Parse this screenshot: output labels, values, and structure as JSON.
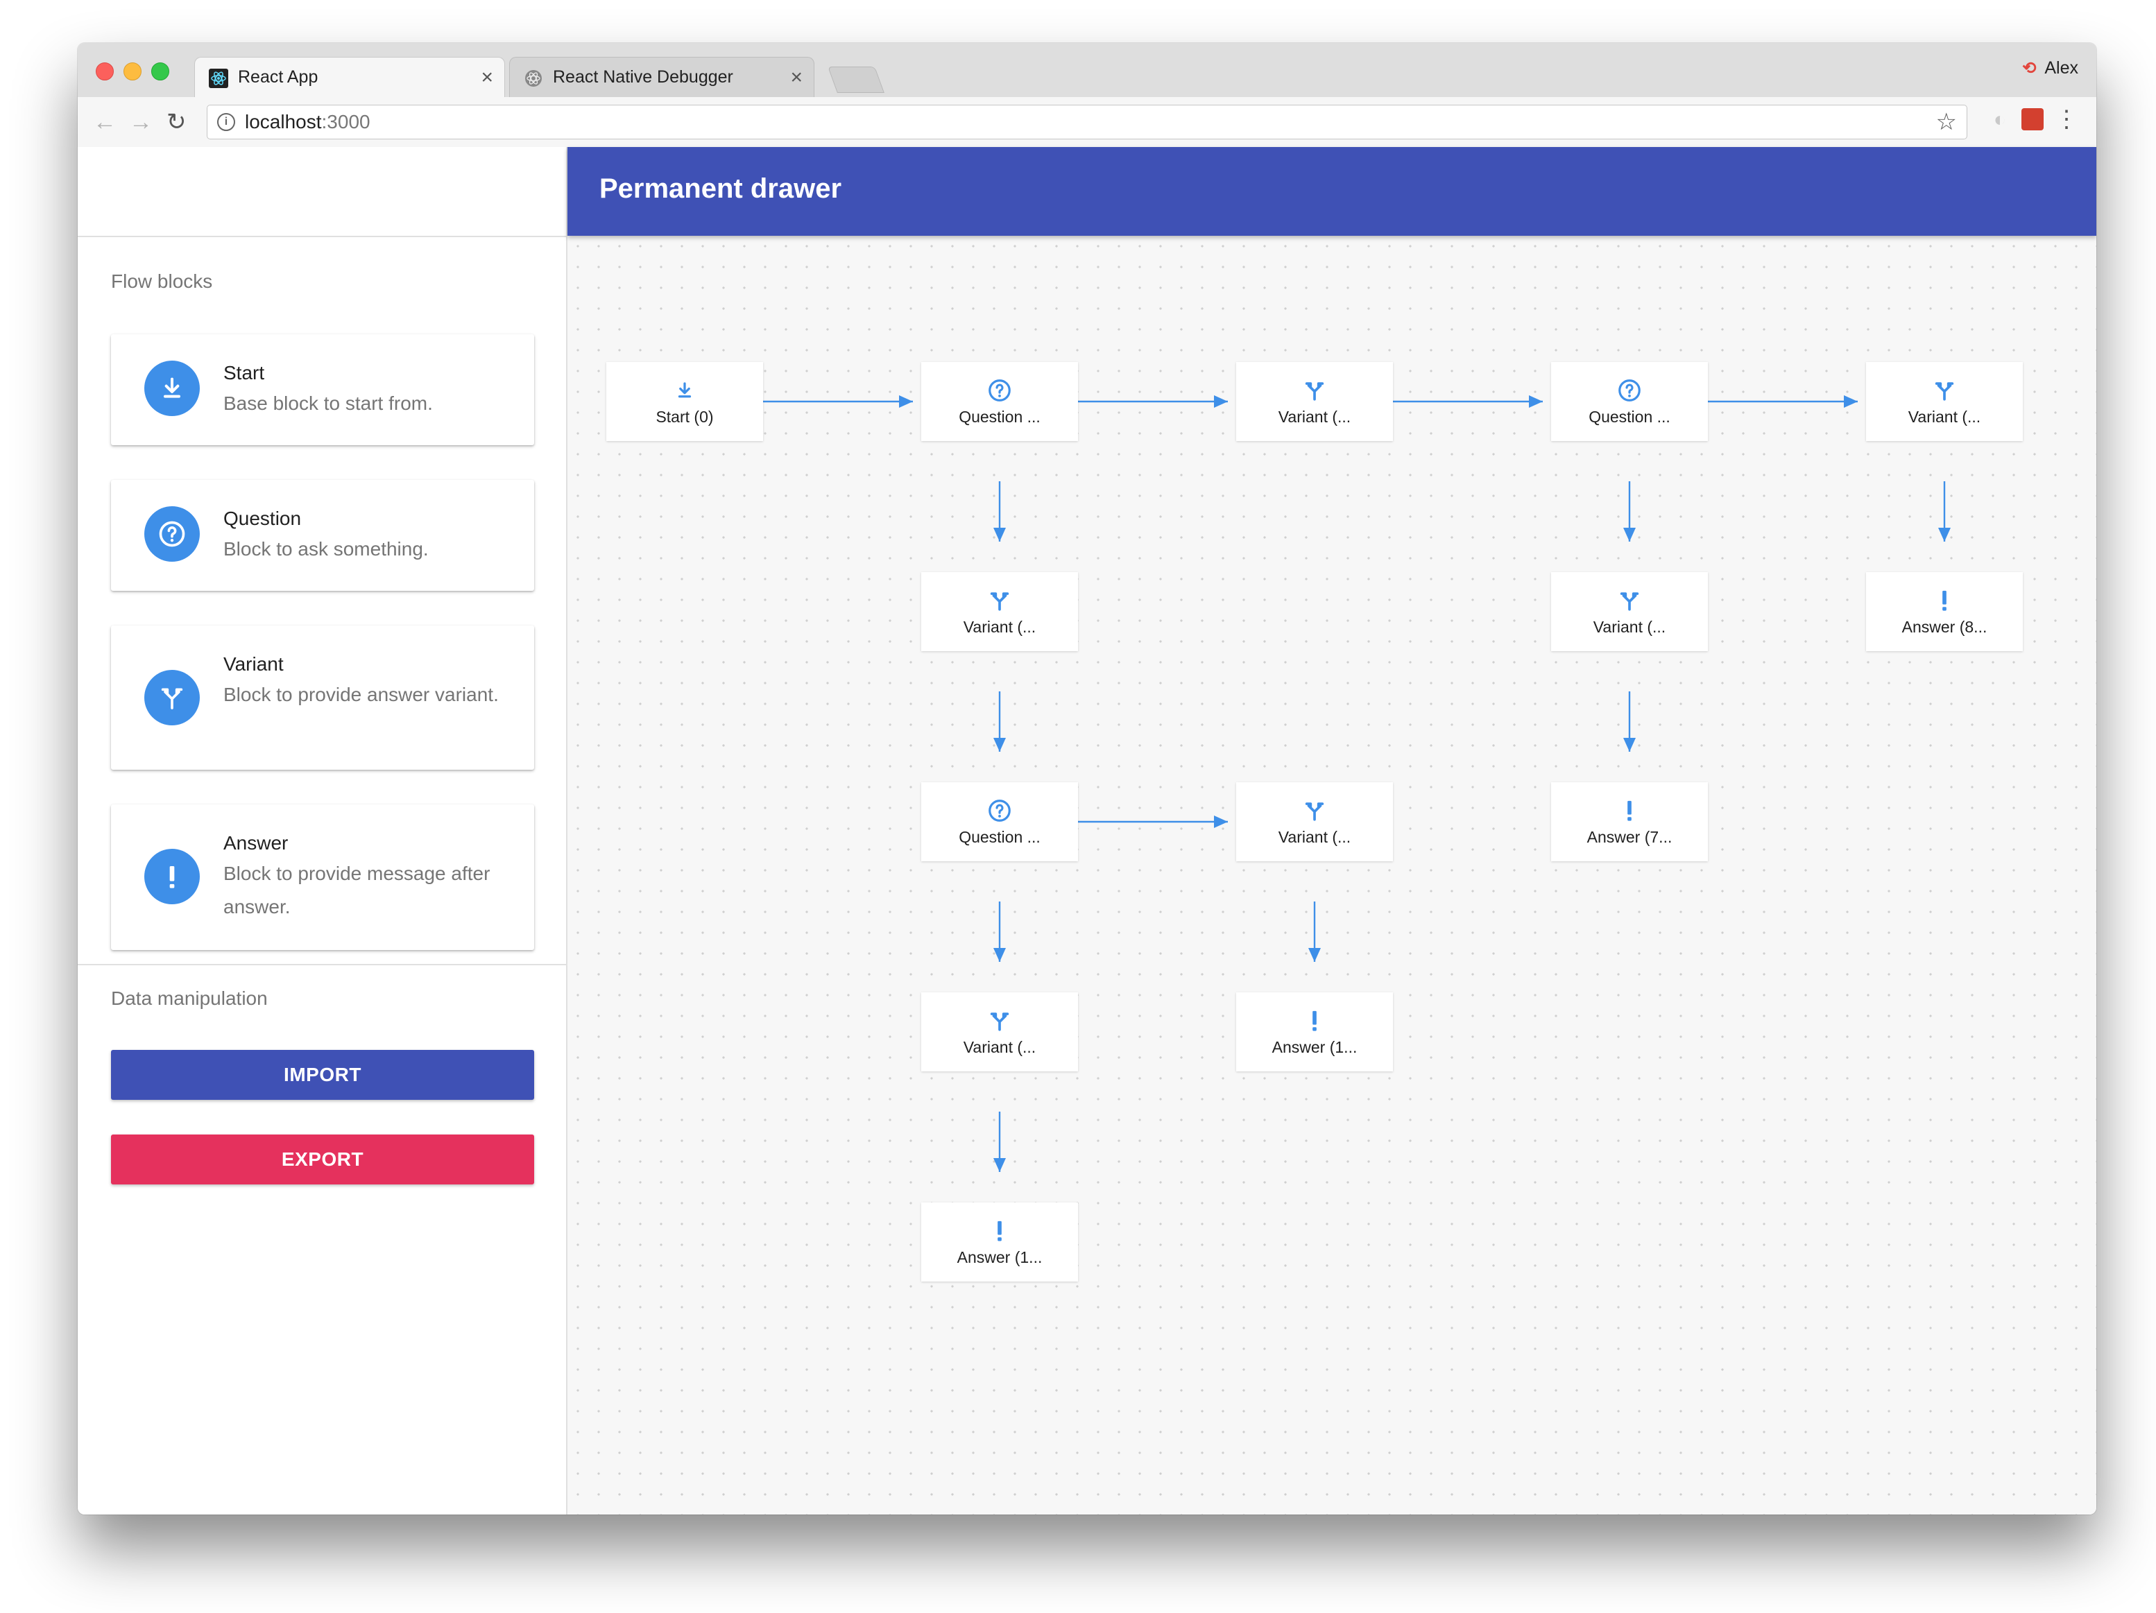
{
  "browser": {
    "tabs": [
      {
        "title": "React App",
        "active": true
      },
      {
        "title": "React Native Debugger",
        "active": false
      }
    ],
    "profile_name": "Alex",
    "url_host": "localhost",
    "url_port": ":3000"
  },
  "app": {
    "title": "Permanent drawer",
    "drawer": {
      "flow_section_title": "Flow blocks",
      "blocks": [
        {
          "title": "Start",
          "description": "Base block to start from.",
          "icon": "download-icon"
        },
        {
          "title": "Question",
          "description": "Block to ask something.",
          "icon": "question-circle-icon"
        },
        {
          "title": "Variant",
          "description": "Block to provide answer variant.",
          "icon": "fork-icon"
        },
        {
          "title": "Answer",
          "description": "Block to provide message after answer.",
          "icon": "exclamation-icon"
        }
      ],
      "data_section_title": "Data manipulation",
      "import_label": "IMPORT",
      "export_label": "EXPORT"
    },
    "canvas": {
      "nodes": [
        {
          "type": "start",
          "label": "Start (0)"
        },
        {
          "type": "question",
          "label": "Question ..."
        },
        {
          "type": "variant",
          "label": "Variant (..."
        },
        {
          "type": "question",
          "label": "Question ..."
        },
        {
          "type": "variant",
          "label": "Variant (..."
        },
        {
          "type": "variant",
          "label": "Variant (..."
        },
        {
          "type": "variant",
          "label": "Variant (..."
        },
        {
          "type": "answer",
          "label": "Answer (8..."
        },
        {
          "type": "question",
          "label": "Question ..."
        },
        {
          "type": "variant",
          "label": "Variant (..."
        },
        {
          "type": "answer",
          "label": "Answer (7..."
        },
        {
          "type": "variant",
          "label": "Variant (..."
        },
        {
          "type": "answer",
          "label": "Answer (1..."
        },
        {
          "type": "answer",
          "label": "Answer (1..."
        }
      ]
    }
  },
  "colors": {
    "primary": "#3f51b5",
    "secondary": "#e5315d",
    "accent_blue": "#3e8fe8"
  }
}
